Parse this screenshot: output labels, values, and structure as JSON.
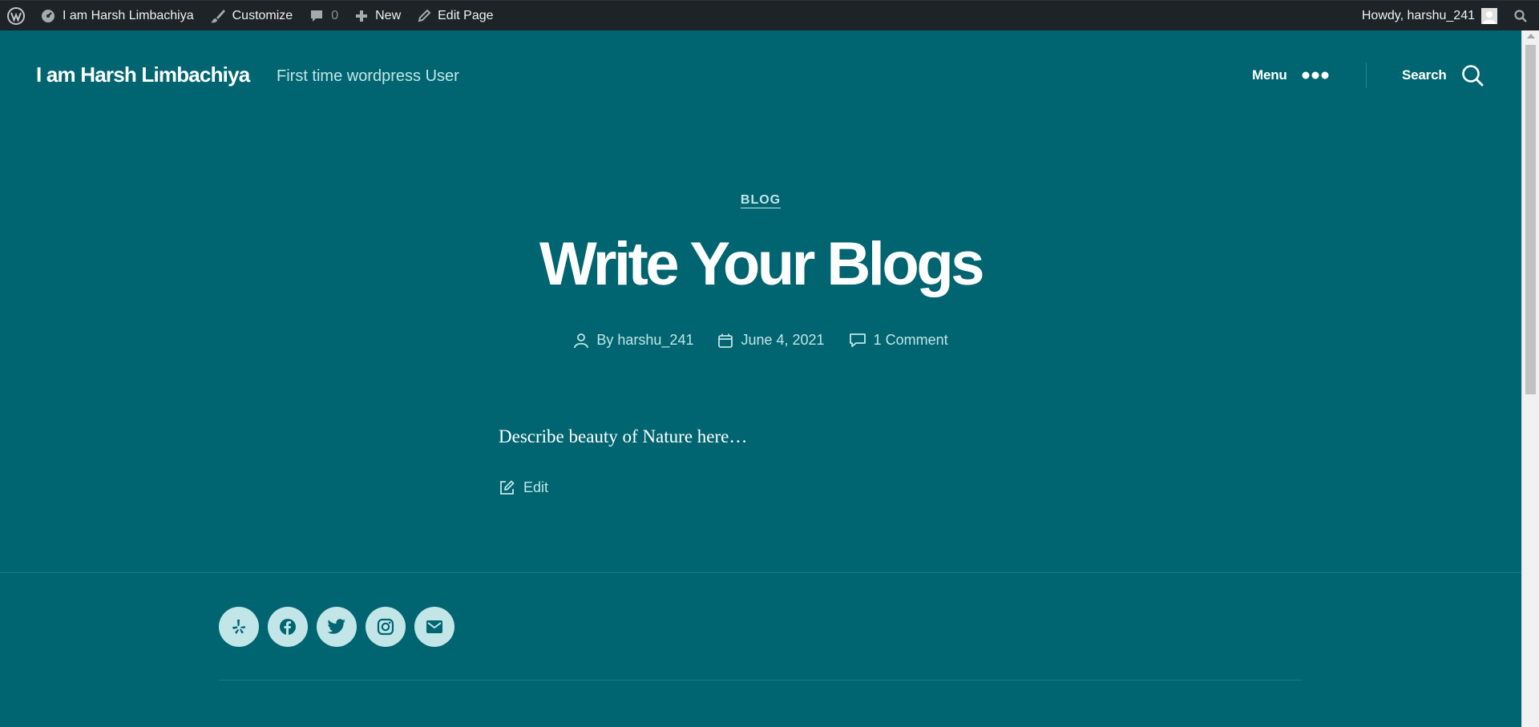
{
  "admin_bar": {
    "site_name": "I am Harsh Limbachiya",
    "customize": "Customize",
    "comments_count": "0",
    "new": "New",
    "edit_page": "Edit Page",
    "greeting": "Howdy, harshu_241"
  },
  "header": {
    "site_title": "I am Harsh Limbachiya",
    "site_description": "First time wordpress User",
    "menu_label": "Menu",
    "search_label": "Search"
  },
  "entry": {
    "category": "BLOG",
    "title": "Write Your Blogs",
    "author": "By harshu_241",
    "date": "June 4, 2021",
    "comments": "1 Comment",
    "content": "Describe beauty of Nature here…",
    "edit_label": "Edit"
  },
  "footer": {
    "social_icons": [
      "yelp-icon",
      "facebook-icon",
      "twitter-icon",
      "instagram-icon",
      "mail-icon"
    ]
  },
  "colors": {
    "background": "#006570",
    "admin_bar": "#1d2327",
    "accent_light": "#c2e6e8"
  }
}
